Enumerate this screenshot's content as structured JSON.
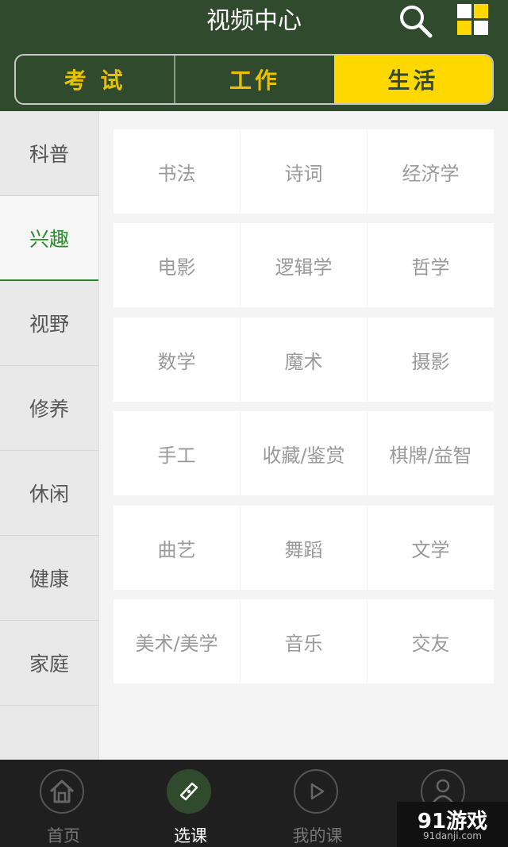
{
  "header": {
    "title": "视频中心",
    "search_icon": "search-icon",
    "grid_icon": "grid-menu-icon",
    "colors": {
      "background": "#2f4a2c",
      "accent": "#ffd800"
    }
  },
  "top_tabs": [
    {
      "label": "考 试",
      "active": false
    },
    {
      "label": "工作",
      "active": false
    },
    {
      "label": "生活",
      "active": true
    }
  ],
  "sidebar": {
    "items": [
      {
        "label": "科普",
        "active": false
      },
      {
        "label": "兴趣",
        "active": true
      },
      {
        "label": "视野",
        "active": false
      },
      {
        "label": "修养",
        "active": false
      },
      {
        "label": "休闲",
        "active": false
      },
      {
        "label": "健康",
        "active": false
      },
      {
        "label": "家庭",
        "active": false
      }
    ]
  },
  "grid": {
    "rows": [
      [
        "书法",
        "诗词",
        "经济学"
      ],
      [
        "电影",
        "逻辑学",
        "哲学"
      ],
      [
        "数学",
        "魔术",
        "摄影"
      ],
      [
        "手工",
        "收藏/鉴赏",
        "棋牌/益智"
      ],
      [
        "曲艺",
        "舞蹈",
        "文学"
      ],
      [
        "美术/美学",
        "音乐",
        "交友"
      ]
    ]
  },
  "bottom_nav": [
    {
      "label": "首页",
      "icon": "home-icon",
      "active": false
    },
    {
      "label": "选课",
      "icon": "compass-icon",
      "active": true
    },
    {
      "label": "我的课",
      "icon": "play-icon",
      "active": false
    },
    {
      "label": "",
      "icon": "user-icon",
      "active": false
    }
  ],
  "watermark": {
    "main": "91游戏",
    "sub": "91danji.com"
  }
}
